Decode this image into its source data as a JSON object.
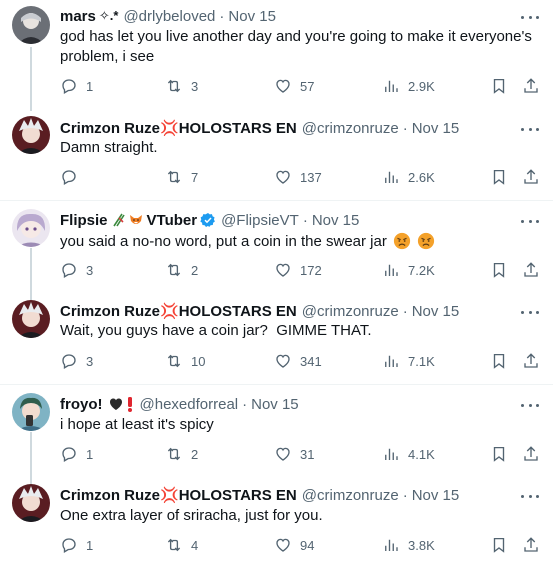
{
  "actions_meta": {
    "reply_icon": "reply-icon",
    "retweet_icon": "retweet-icon",
    "like_icon": "like-icon",
    "views_icon": "views-icon",
    "bookmark_icon": "bookmark-icon",
    "share_icon": "share-icon"
  },
  "colors": {
    "text": "#0f1419",
    "secondary": "#536471",
    "separator": "#eff3f4",
    "verified": "#1d9bf0",
    "thread_line": "#cfd9de"
  },
  "tweets": [
    {
      "name": "mars",
      "name_suffix": "✧.*",
      "handle": "@drlybeloved",
      "dot": "·",
      "date": "Nov 15",
      "text": "god has let you live another day and you're going to make it everyone's problem, i see",
      "reply": "1",
      "retweet": "3",
      "like": "57",
      "views": "2.9K"
    },
    {
      "name": "Crimzon Ruze",
      "name_suffix": "💢HOLOSTARS EN",
      "handle": "@crimzonruze",
      "dot": "·",
      "date": "Nov 15",
      "text": "Damn straight.",
      "reply": "",
      "retweet": "7",
      "like": "137",
      "views": "2.6K"
    },
    {
      "name": "Flipsie",
      "name_suffix": "VTuber",
      "handle": "@FlipsieVT",
      "dot": "·",
      "date": "Nov 15",
      "text": "you said a no-no word, put a coin in the swear jar",
      "reply": "3",
      "retweet": "2",
      "like": "172",
      "views": "7.2K"
    },
    {
      "name": "Crimzon Ruze",
      "name_suffix": "💢HOLOSTARS EN",
      "handle": "@crimzonruze",
      "dot": "·",
      "date": "Nov 15",
      "text": "Wait, you guys have a coin jar?  GIMME THAT.",
      "reply": "3",
      "retweet": "10",
      "like": "341",
      "views": "7.1K"
    },
    {
      "name": "froyo!",
      "name_suffix": "",
      "handle": "@hexedforreal",
      "dot": "·",
      "date": "Nov 15",
      "text": "i hope at least it's spicy",
      "reply": "1",
      "retweet": "2",
      "like": "31",
      "views": "4.1K"
    },
    {
      "name": "Crimzon Ruze",
      "name_suffix": "💢HOLOSTARS EN",
      "handle": "@crimzonruze",
      "dot": "·",
      "date": "Nov 15",
      "text": "One extra layer of sriracha, just for you.",
      "reply": "1",
      "retweet": "4",
      "like": "94",
      "views": "3.8K"
    }
  ]
}
